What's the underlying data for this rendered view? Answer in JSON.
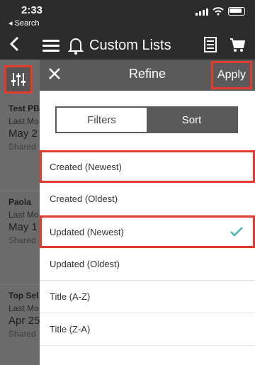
{
  "status_bar": {
    "time": "2:33",
    "back_label": "◂ Search"
  },
  "header": {
    "title": "Custom Lists"
  },
  "lists": [
    {
      "title": "Test PB",
      "meta": "Last Mo",
      "date": "May 2",
      "shared": "Shared"
    },
    {
      "title": "Paola",
      "meta": "Last Mo",
      "date": "May 1",
      "shared": "Shared"
    },
    {
      "title": "Top Sel",
      "meta": "Last Mo",
      "date": "Apr 25",
      "shared": "Shared"
    }
  ],
  "refine": {
    "title": "Refine",
    "apply_label": "Apply",
    "tabs": {
      "filters": "Filters",
      "sort": "Sort"
    },
    "options": [
      {
        "label": "Created (Newest)"
      },
      {
        "label": "Created (Oldest)"
      },
      {
        "label": "Updated (Newest)",
        "selected": true
      },
      {
        "label": "Updated (Oldest)"
      },
      {
        "label": "Title (A-Z)"
      },
      {
        "label": "Title (Z-A)"
      }
    ]
  },
  "colors": {
    "highlight": "#e53b2c",
    "check": "#45b3b9",
    "header": "#2c2c2c",
    "panel_header": "#5a5a5a"
  }
}
